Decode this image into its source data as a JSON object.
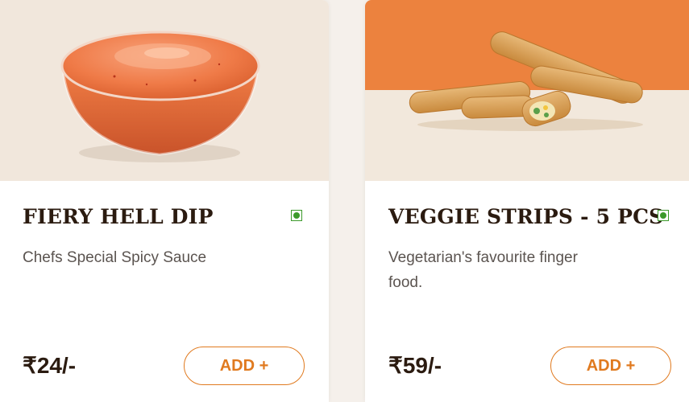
{
  "colors": {
    "accent": "#e07a1f",
    "title": "#2b1b10",
    "veg": "#3c9a2b",
    "image_bg": "#f0e6dc",
    "band": "#ec823e"
  },
  "products": [
    {
      "image_icon": "dip-bowl-image",
      "title": "FIERY HELL DIP",
      "description": "Chefs Special Spicy Sauce",
      "veg_icon": "veg-indicator-icon",
      "price": "₹24/-",
      "add_label": "ADD +"
    },
    {
      "image_icon": "veggie-strips-image",
      "title": "VEGGIE STRIPS - 5 PCS",
      "description_lines": [
        "Vegetarian's favourite finger",
        "food."
      ],
      "veg_icon": "veg-indicator-icon",
      "price": "₹59/-",
      "add_label": "ADD +"
    }
  ]
}
